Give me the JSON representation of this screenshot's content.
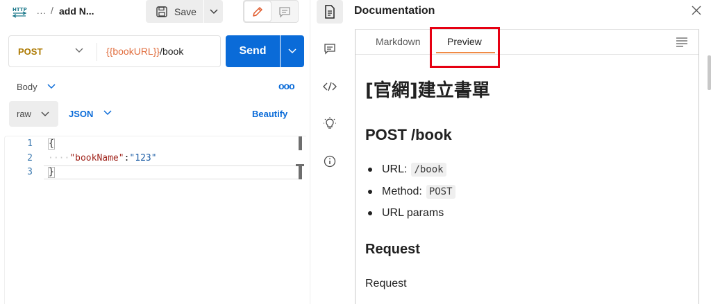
{
  "header": {
    "breadcrumb_dots": "...",
    "breadcrumb_sep": "/",
    "request_name": "add N...",
    "save_label": "Save"
  },
  "request": {
    "method": "POST",
    "url_variable": "{{bookURL}}",
    "url_path": "/book",
    "send_label": "Send"
  },
  "body_section": {
    "label": "Body",
    "more": "ooo",
    "mode": "raw",
    "format": "JSON",
    "beautify_label": "Beautify"
  },
  "editor": {
    "line_numbers": [
      "1",
      "2",
      "3"
    ],
    "line1": "{",
    "indent": "····",
    "key": "\"bookName\"",
    "colon": ":",
    "value": "\"123\"",
    "line3": "}"
  },
  "rail": {
    "icons": [
      "documentation-icon",
      "comments-icon",
      "code-icon",
      "lightbulb-icon",
      "info-icon"
    ]
  },
  "documentation": {
    "title": "Documentation",
    "tabs": {
      "markdown": "Markdown",
      "preview": "Preview"
    },
    "active_tab": "Preview",
    "preview": {
      "h1": "[官網]建立書單",
      "h2": "POST /book",
      "items": [
        {
          "label": "URL:",
          "code": "/book"
        },
        {
          "label": "Method:",
          "code": "POST"
        },
        {
          "label": "URL params",
          "code": ""
        }
      ],
      "h2b": "Request",
      "paragraph": "Request"
    }
  },
  "colors": {
    "send_blue": "#0a6bd8",
    "method_post": "#ad7a03",
    "url_variable": "#e06c3c",
    "tab_underline": "#f08a45",
    "highlight_red": "#e60012"
  }
}
